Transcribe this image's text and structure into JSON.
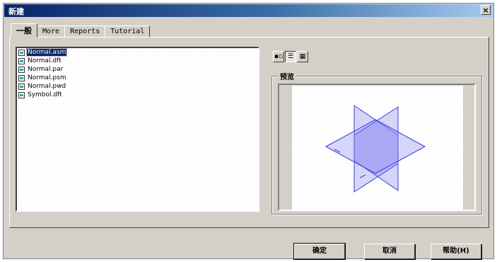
{
  "window": {
    "title": "新建",
    "close_glyph": "×"
  },
  "tabs": [
    {
      "label": "一般",
      "active": true
    },
    {
      "label": "More",
      "active": false
    },
    {
      "label": "Reports",
      "active": false
    },
    {
      "label": "Tutorial",
      "active": false
    }
  ],
  "files": [
    {
      "name": "Normal.asm",
      "selected": true
    },
    {
      "name": "Normal.dft",
      "selected": false
    },
    {
      "name": "Normal.par",
      "selected": false
    },
    {
      "name": "Normal.psm",
      "selected": false
    },
    {
      "name": "Normal.pwd",
      "selected": false
    },
    {
      "name": "Symbol.dft",
      "selected": false
    }
  ],
  "view_buttons": [
    {
      "icon": "large-icons-icon",
      "glyph": "▪▫",
      "active": false
    },
    {
      "icon": "list-view-icon",
      "glyph": "☰",
      "active": true
    },
    {
      "icon": "details-view-icon",
      "glyph": "▦",
      "active": false
    }
  ],
  "preview": {
    "label": "预览"
  },
  "buttons": {
    "ok": "确定",
    "cancel": "取消",
    "help": "帮助(H)"
  },
  "colors": {
    "title_start": "#0a246a",
    "title_end": "#a6caf0",
    "preview_plane": "#8a8af0",
    "preview_edge": "#3a3ae0"
  }
}
